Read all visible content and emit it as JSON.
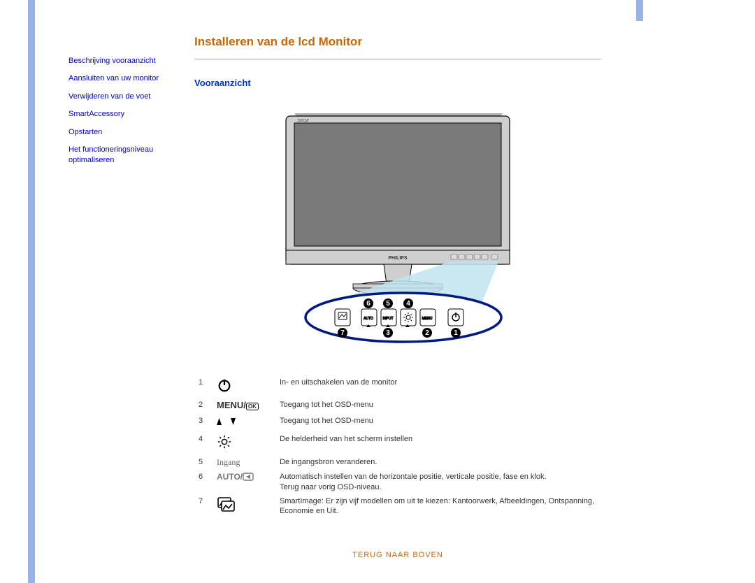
{
  "page": {
    "title": "Installeren van de lcd Monitor",
    "section_heading": "Vooraanzicht",
    "back_to_top": "TERUG NAAR BOVEN"
  },
  "sidebar": {
    "items": [
      {
        "label": "Beschrijving vooraanzicht"
      },
      {
        "label": "Aansluiten van uw monitor"
      },
      {
        "label": "Verwijderen van de voet"
      },
      {
        "label": "SmartAccessory"
      },
      {
        "label": "Opstarten"
      },
      {
        "label": "Het functioneringsniveau optimaliseren"
      }
    ]
  },
  "monitor": {
    "brand": "PHILIPS",
    "model": "190CW",
    "button_labels": {
      "auto": "AUTO",
      "input": "INPUT",
      "menu": "MENU"
    },
    "callouts_top": [
      "6",
      "5",
      "4"
    ],
    "callouts_bottom": [
      "7",
      "3",
      "2",
      "1"
    ]
  },
  "controls": [
    {
      "num": "1",
      "icon": "power",
      "desc": "In- en uitschakelen van de monitor"
    },
    {
      "num": "2",
      "icon": "menu",
      "desc": "Toegang tot het OSD-menu"
    },
    {
      "num": "3",
      "icon": "updown",
      "desc": "Toegang tot het OSD-menu"
    },
    {
      "num": "4",
      "icon": "brightness",
      "desc": "De helderheid van het scherm instellen"
    },
    {
      "num": "5",
      "icon": "ingang",
      "desc": "De ingangsbron veranderen."
    },
    {
      "num": "6",
      "icon": "auto",
      "desc": "Automatisch instellen van de horizontale positie, verticale positie, fase en klok.\nTerug naar vorig OSD-niveau."
    },
    {
      "num": "7",
      "icon": "smartimage",
      "desc": "SmartImage: Er zijn vijf modellen om uit te kiezen: Kantoorwerk, Afbeeldingen, Ontspanning, Economie en Uit."
    }
  ],
  "icon_text": {
    "menu": "MENU/",
    "ok": "OK",
    "auto": "AUTO/",
    "ingang": "Ingang"
  }
}
